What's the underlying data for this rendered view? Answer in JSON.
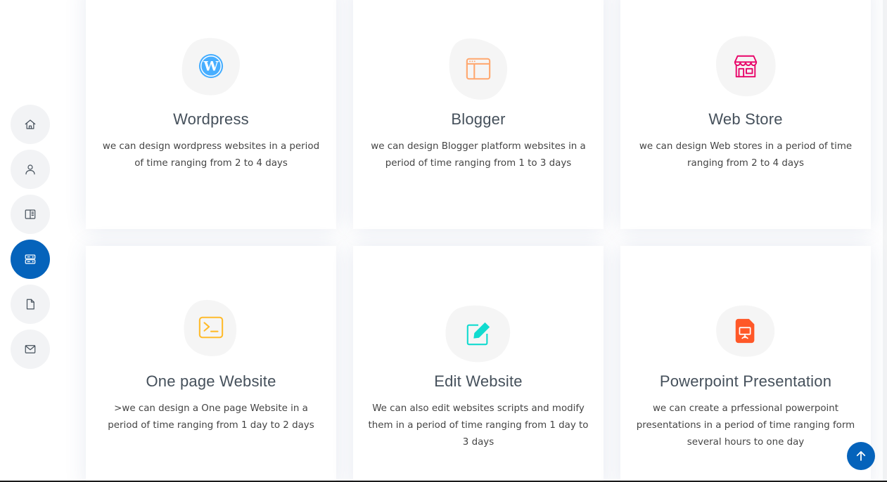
{
  "nav": [
    {
      "name": "home",
      "icon": "house-icon",
      "active": false
    },
    {
      "name": "about",
      "icon": "person-icon",
      "active": false
    },
    {
      "name": "resume",
      "icon": "book-icon",
      "active": false
    },
    {
      "name": "services",
      "icon": "server-icon",
      "active": true
    },
    {
      "name": "portfolio",
      "icon": "file-icon",
      "active": false
    },
    {
      "name": "contact",
      "icon": "envelope-icon",
      "active": false
    }
  ],
  "services": [
    {
      "title": "Wordpress",
      "description": "we can design wordpress websites in a period of time ranging from 2 to 4 days",
      "icon": "wordpress-icon",
      "icon_color": "#47aeff"
    },
    {
      "title": "Blogger",
      "description": "we can design Blogger platform websites in a period of time ranging from 1 to 3 days",
      "icon": "browser-window-icon",
      "icon_color": "#ffa76e"
    },
    {
      "title": "Web Store",
      "description": "we can design Web stores in a period of time ranging from 2 to 4 days",
      "icon": "shop-icon",
      "icon_color": "#e80368"
    },
    {
      "title": "One page Website",
      "description": ">we can design a One page Website in a period of time ranging from 1 day to 2 days",
      "icon": "terminal-icon",
      "icon_color": "#ffbb2c"
    },
    {
      "title": "Edit Website",
      "description": "We can also edit websites scripts and modify them in a period of time ranging from 1 day to 3 days",
      "icon": "edit-icon",
      "icon_color": "#11dbcf"
    },
    {
      "title": "Powerpoint Presentation",
      "description": "we can create a prfessional powerpoint presentations in a period of time ranging form several hours to one day",
      "icon": "presentation-file-icon",
      "icon_color": "#ff5828"
    }
  ],
  "colors": {
    "accent": "#0563bb",
    "heading": "#45505b",
    "text": "#444444",
    "blob": "#f5f5f5"
  },
  "back_to_top": {
    "icon": "arrow-up-icon"
  }
}
